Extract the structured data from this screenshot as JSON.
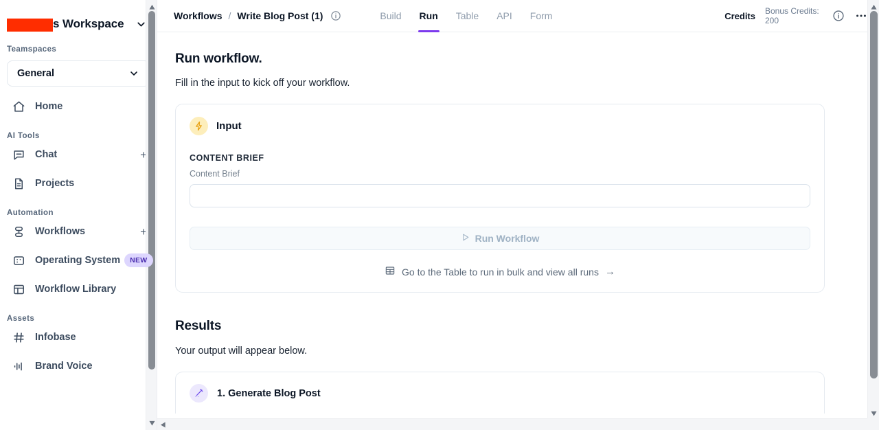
{
  "sidebar": {
    "workspace_title_suffix": "s Workspace",
    "workspace_redacted": true,
    "teamspaces_label": "Teamspaces",
    "teamspace_selected": "General",
    "groups": [
      {
        "label": "",
        "items": [
          {
            "label": "Home",
            "icon": "home-icon",
            "plus": false,
            "badge": ""
          }
        ]
      },
      {
        "label": "AI Tools",
        "items": [
          {
            "label": "Chat",
            "icon": "chat-bubble-icon",
            "plus": true,
            "badge": ""
          },
          {
            "label": "Projects",
            "icon": "document-icon",
            "plus": false,
            "badge": ""
          }
        ]
      },
      {
        "label": "Automation",
        "items": [
          {
            "label": "Workflows",
            "icon": "workflow-icon",
            "plus": true,
            "badge": ""
          },
          {
            "label": "Operating System",
            "icon": "os-chip-icon",
            "plus": false,
            "badge": "NEW"
          },
          {
            "label": "Workflow Library",
            "icon": "library-layout-icon",
            "plus": false,
            "badge": ""
          }
        ]
      },
      {
        "label": "Assets",
        "items": [
          {
            "label": "Infobase",
            "icon": "hash-icon",
            "plus": false,
            "badge": ""
          },
          {
            "label": "Brand Voice",
            "icon": "waveform-icon",
            "plus": false,
            "badge": ""
          }
        ]
      }
    ]
  },
  "topbar": {
    "breadcrumb_root": "Workflows",
    "breadcrumb_sep": "/",
    "breadcrumb_current": "Write Blog Post (1)",
    "info_icon": "info-circle-icon",
    "tabs": [
      {
        "label": "Build",
        "active": false
      },
      {
        "label": "Run",
        "active": true
      },
      {
        "label": "Table",
        "active": false
      },
      {
        "label": "API",
        "active": false
      },
      {
        "label": "Form",
        "active": false
      }
    ],
    "credits_label": "Credits",
    "bonus_credits": "Bonus Credits: 200",
    "help_icon": "info-circle-icon",
    "more_icon": "ellipsis-icon",
    "active_tab_color": "#7c3aed"
  },
  "main": {
    "title": "Run workflow.",
    "subtitle": "Fill in the input to kick off your workflow.",
    "input_card": {
      "icon": "zap-icon",
      "icon_bg": "#fdeebb",
      "heading": "Input",
      "field_label": "CONTENT BRIEF",
      "field_sublabel": "Content Brief",
      "field_value": "",
      "field_placeholder": "",
      "run_button_label": "Run Workflow",
      "run_button_icon": "play-triangle-icon",
      "run_button_disabled": true,
      "bulk_link_label": "Go to the Table to run in bulk and view all runs",
      "bulk_link_icon": "table-grid-icon",
      "bulk_link_arrow": "→"
    },
    "results": {
      "title": "Results",
      "subtitle": "Your output will appear below.",
      "items": [
        {
          "label": "1. Generate Blog Post",
          "icon": "magic-wand-icon",
          "icon_bg": "#ece8fd"
        }
      ]
    }
  }
}
